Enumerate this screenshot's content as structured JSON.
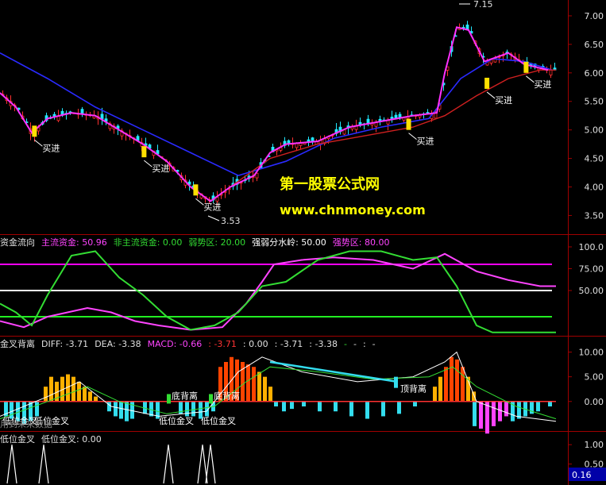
{
  "chart_data": [
    {
      "type": "candlestick",
      "panel": "price",
      "ylim": [
        3.2,
        7.25
      ],
      "yticks": [
        "7.00",
        "6.50",
        "6.00",
        "5.50",
        "5.00",
        "4.50",
        "4.00",
        "3.50"
      ],
      "high_label": "7.15",
      "low_label": "3.53",
      "buy_label": "买进",
      "buy_signals": [
        {
          "bar": 44,
          "price": 4.88
        },
        {
          "bar": 184,
          "price": 4.52
        },
        {
          "bar": 250,
          "price": 3.85
        },
        {
          "bar": 522,
          "price": 5.0
        },
        {
          "bar": 622,
          "price": 5.72
        },
        {
          "bar": 672,
          "price": 6.0
        }
      ],
      "close_path": [
        [
          0,
          5.65
        ],
        [
          20,
          5.4
        ],
        [
          40,
          4.95
        ],
        [
          60,
          5.2
        ],
        [
          90,
          5.3
        ],
        [
          120,
          5.25
        ],
        [
          150,
          5.0
        ],
        [
          180,
          4.75
        ],
        [
          210,
          4.45
        ],
        [
          240,
          4.0
        ],
        [
          265,
          3.75
        ],
        [
          290,
          4.0
        ],
        [
          320,
          4.2
        ],
        [
          340,
          4.6
        ],
        [
          360,
          4.75
        ],
        [
          400,
          4.8
        ],
        [
          440,
          5.05
        ],
        [
          480,
          5.15
        ],
        [
          520,
          5.25
        ],
        [
          550,
          5.3
        ],
        [
          560,
          6.0
        ],
        [
          575,
          6.8
        ],
        [
          590,
          6.75
        ],
        [
          610,
          6.2
        ],
        [
          640,
          6.35
        ],
        [
          660,
          6.15
        ],
        [
          690,
          6.05
        ]
      ],
      "ma_long_path": [
        [
          0,
          6.35
        ],
        [
          60,
          5.9
        ],
        [
          120,
          5.4
        ],
        [
          180,
          5.0
        ],
        [
          240,
          4.6
        ],
        [
          300,
          4.2
        ],
        [
          360,
          4.45
        ],
        [
          420,
          4.85
        ],
        [
          480,
          5.05
        ],
        [
          540,
          5.2
        ],
        [
          580,
          5.9
        ],
        [
          620,
          6.25
        ],
        [
          660,
          6.2
        ],
        [
          695,
          6.05
        ]
      ],
      "ma_red_path": [
        [
          290,
          4.0
        ],
        [
          340,
          4.5
        ],
        [
          400,
          4.75
        ],
        [
          460,
          4.9
        ],
        [
          520,
          5.05
        ],
        [
          560,
          5.25
        ],
        [
          600,
          5.6
        ],
        [
          640,
          5.9
        ],
        [
          680,
          6.05
        ],
        [
          700,
          6.05
        ]
      ],
      "watermark_cn": "第一股票公式网",
      "watermark_url": "www.chnmoney.com"
    },
    {
      "type": "line",
      "panel": "fund_flow",
      "legend": [
        {
          "text": "资金流向",
          "color": "#e0e0e0"
        },
        {
          "text": "主流资金: 50.96",
          "color": "#ff44ff"
        },
        {
          "text": "非主流资金: 0.00",
          "color": "#33dd33"
        },
        {
          "text": "弱势区: 20.00",
          "color": "#33dd33"
        },
        {
          "text": "强弱分水岭: 50.00",
          "color": "#ffffff"
        },
        {
          "text": "强势区: 80.00",
          "color": "#ff44ff"
        }
      ],
      "ylim": [
        0,
        110
      ],
      "yticks": [
        "100.0",
        "75.00",
        "50.00"
      ],
      "levels": [
        {
          "value": 80,
          "color": "#ff00ff"
        },
        {
          "value": 50,
          "color": "#ffffff"
        },
        {
          "value": 20,
          "color": "#22ee22"
        }
      ],
      "series": [
        {
          "color": "#ff44ff",
          "points": [
            [
              0,
              15
            ],
            [
              30,
              8
            ],
            [
              60,
              20
            ],
            [
              110,
              30
            ],
            [
              140,
              25
            ],
            [
              170,
              15
            ],
            [
              200,
              10
            ],
            [
              240,
              5
            ],
            [
              280,
              8
            ],
            [
              310,
              35
            ],
            [
              330,
              60
            ],
            [
              345,
              80
            ],
            [
              380,
              85
            ],
            [
              420,
              88
            ],
            [
              470,
              85
            ],
            [
              520,
              75
            ],
            [
              560,
              92
            ],
            [
              600,
              72
            ],
            [
              640,
              62
            ],
            [
              680,
              55
            ],
            [
              700,
              55
            ]
          ]
        },
        {
          "color": "#33dd33",
          "points": [
            [
              0,
              35
            ],
            [
              20,
              25
            ],
            [
              40,
              10
            ],
            [
              60,
              45
            ],
            [
              90,
              90
            ],
            [
              120,
              95
            ],
            [
              150,
              65
            ],
            [
              180,
              45
            ],
            [
              210,
              20
            ],
            [
              240,
              5
            ],
            [
              270,
              10
            ],
            [
              300,
              25
            ],
            [
              330,
              55
            ],
            [
              360,
              60
            ],
            [
              400,
              85
            ],
            [
              440,
              95
            ],
            [
              480,
              95
            ],
            [
              520,
              85
            ],
            [
              550,
              88
            ],
            [
              575,
              55
            ],
            [
              600,
              10
            ],
            [
              620,
              2
            ],
            [
              700,
              2
            ]
          ]
        }
      ]
    },
    {
      "type": "bar",
      "panel": "macd",
      "legend": [
        {
          "text": "金叉背离",
          "color": "#e0e0e0"
        },
        {
          "text": "DIFF: -3.71",
          "color": "#e0e0e0"
        },
        {
          "text": "DEA: -3.38",
          "color": "#e0e0e0"
        },
        {
          "text": "MACD: -0.66",
          "color": "#ff44ff"
        },
        {
          "text": ": -3.71",
          "color": "#ff3333"
        },
        {
          "text": ": 0.00",
          "color": "#e0e0e0"
        },
        {
          "text": ": -3.71",
          "color": "#e0e0e0"
        },
        {
          "text": ": -3.38",
          "color": "#e0e0e0"
        },
        {
          "text": "-",
          "color": "#33dd33"
        },
        {
          "text": "-",
          "color": "#e0e0e0"
        },
        {
          "text": ":",
          "color": "#e0e0e0"
        },
        {
          "text": "-",
          "color": "#e0e0e0"
        }
      ],
      "ylim": [
        -5.5,
        12.5
      ],
      "yticks": [
        "10.00",
        "5.00",
        "0.00"
      ],
      "positive_bars": [
        [
          55,
          3
        ],
        [
          62,
          5
        ],
        [
          69,
          4
        ],
        [
          76,
          5
        ],
        [
          83,
          5.5
        ],
        [
          90,
          5
        ],
        [
          97,
          4
        ],
        [
          104,
          3
        ],
        [
          111,
          2
        ],
        [
          118,
          1
        ],
        [
          275,
          7
        ],
        [
          282,
          8
        ],
        [
          289,
          9
        ],
        [
          296,
          8.5
        ],
        [
          303,
          8
        ],
        [
          310,
          7.5
        ],
        [
          317,
          7
        ],
        [
          324,
          6
        ],
        [
          331,
          5
        ],
        [
          338,
          3
        ],
        [
          545,
          3
        ],
        [
          552,
          5
        ],
        [
          559,
          7
        ],
        [
          566,
          9
        ],
        [
          573,
          8.5
        ],
        [
          580,
          7
        ],
        [
          587,
          5
        ],
        [
          594,
          2
        ]
      ],
      "negative_bars": [
        [
          5,
          -3
        ],
        [
          12,
          -3.5
        ],
        [
          20,
          -4
        ],
        [
          28,
          -4.5
        ],
        [
          36,
          -4
        ],
        [
          44,
          -3
        ],
        [
          135,
          -2
        ],
        [
          143,
          -3
        ],
        [
          150,
          -3.5
        ],
        [
          157,
          -4
        ],
        [
          164,
          -3.5
        ],
        [
          180,
          -2.5
        ],
        [
          188,
          -3
        ],
        [
          196,
          -3.5
        ],
        [
          225,
          -2.5
        ],
        [
          233,
          -3
        ],
        [
          241,
          -3
        ],
        [
          250,
          -3.5
        ],
        [
          258,
          -3
        ],
        [
          266,
          -2
        ],
        [
          345,
          -1
        ],
        [
          355,
          -2
        ],
        [
          365,
          -1.5
        ],
        [
          380,
          -1
        ],
        [
          400,
          -2
        ],
        [
          420,
          -2
        ],
        [
          440,
          -3
        ],
        [
          460,
          -3.5
        ],
        [
          480,
          -3
        ],
        [
          500,
          -2.5
        ],
        [
          520,
          -1
        ],
        [
          595,
          -5
        ],
        [
          603,
          -5.5
        ],
        [
          611,
          -6.5
        ],
        [
          619,
          -5
        ],
        [
          627,
          -4
        ],
        [
          635,
          -3
        ],
        [
          643,
          -4
        ],
        [
          651,
          -3.5
        ],
        [
          659,
          -3
        ],
        [
          667,
          -2.5
        ],
        [
          675,
          -2
        ],
        [
          690,
          -1
        ]
      ],
      "signals": [
        {
          "x": 15,
          "label": "低位金叉",
          "kind": "golden"
        },
        {
          "x": 55,
          "label": "低位金叉",
          "kind": "golden"
        },
        {
          "x": 212,
          "label": "低位金叉",
          "kind": "golden"
        },
        {
          "x": 265,
          "label": "低位金叉",
          "kind": "golden"
        },
        {
          "x": 212,
          "label": "底背离",
          "kind": "bottom"
        },
        {
          "x": 265,
          "label": "底背离",
          "kind": "bottom"
        },
        {
          "x": 500,
          "label": "顶背离",
          "kind": "top"
        }
      ],
      "future_data_note": "用到未来数据"
    },
    {
      "type": "line",
      "panel": "golden_cross",
      "legend": [
        {
          "text": "低位金叉",
          "color": "#e0e0e0"
        },
        {
          "text": "低位金叉: 0.00",
          "color": "#e0e0e0"
        }
      ],
      "ylim": [
        0,
        1.25
      ],
      "yticks": [
        "1.00",
        "0.50"
      ],
      "current_value": "0.16",
      "spikes": [
        15,
        55,
        212,
        255,
        265
      ]
    }
  ]
}
